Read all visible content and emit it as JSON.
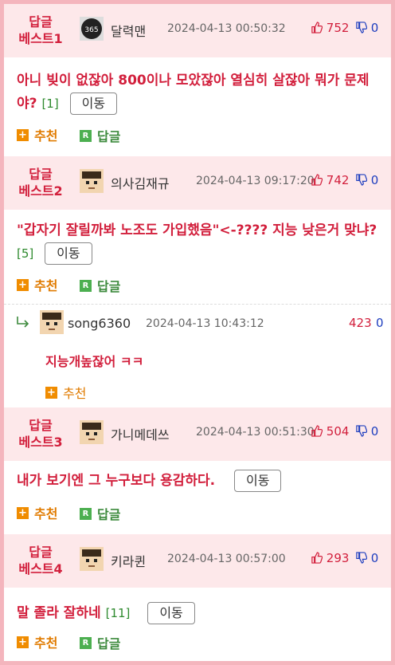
{
  "posts": [
    {
      "badge_l1": "답글",
      "badge_l2": "베스트1",
      "nick": "달력맨",
      "date": "2024-04-13 00:50:32",
      "up": "752",
      "down": "0",
      "text": "아니 빚이 없잖아 800이나 모았잖아 열심히 살잖아 뭐가 문제야?",
      "count": "[1]",
      "move": "이동",
      "recommend": "추천",
      "reply": "답글"
    },
    {
      "badge_l1": "답글",
      "badge_l2": "베스트2",
      "nick": "의사김재규",
      "date": "2024-04-13 09:17:20",
      "up": "742",
      "down": "0",
      "text": "\"갑자기 잘릴까봐 노조도 가입했음\"<-???? 지능 낮은거 맞냐?",
      "count": "[5]",
      "move": "이동",
      "recommend": "추천",
      "reply": "답글"
    },
    {
      "badge_l1": "답글",
      "badge_l2": "베스트3",
      "nick": "가니메데쓰",
      "date": "2024-04-13 00:51:30",
      "up": "504",
      "down": "0",
      "text": "내가 보기엔 그 누구보다 용감하다.",
      "count": "",
      "move": "이동",
      "recommend": "추천",
      "reply": "답글"
    },
    {
      "badge_l1": "답글",
      "badge_l2": "베스트4",
      "nick": "키라퀸",
      "date": "2024-04-13 00:57:00",
      "up": "293",
      "down": "0",
      "text": "말 졸라 잘하네",
      "count": "[11]",
      "move": "이동",
      "recommend": "추천",
      "reply": "답글"
    }
  ],
  "reply": {
    "nick": "song6360",
    "date": "2024-04-13 10:43:12",
    "up": "423",
    "down": "0",
    "text": "지능개높잖어 ㅋㅋ",
    "recommend": "추천"
  },
  "icons": {
    "reply_arrow": "reply-arrow-icon",
    "thumb_up": "thumbs-up-icon",
    "thumb_down": "thumbs-down-icon",
    "plus": "plus-icon",
    "r": "r-icon"
  },
  "colors": {
    "accent": "#d21f3c",
    "header_bg": "#fde8ea",
    "border": "#f4b5bd",
    "recommend": "#e07b00",
    "reply": "#3d8a3d"
  }
}
